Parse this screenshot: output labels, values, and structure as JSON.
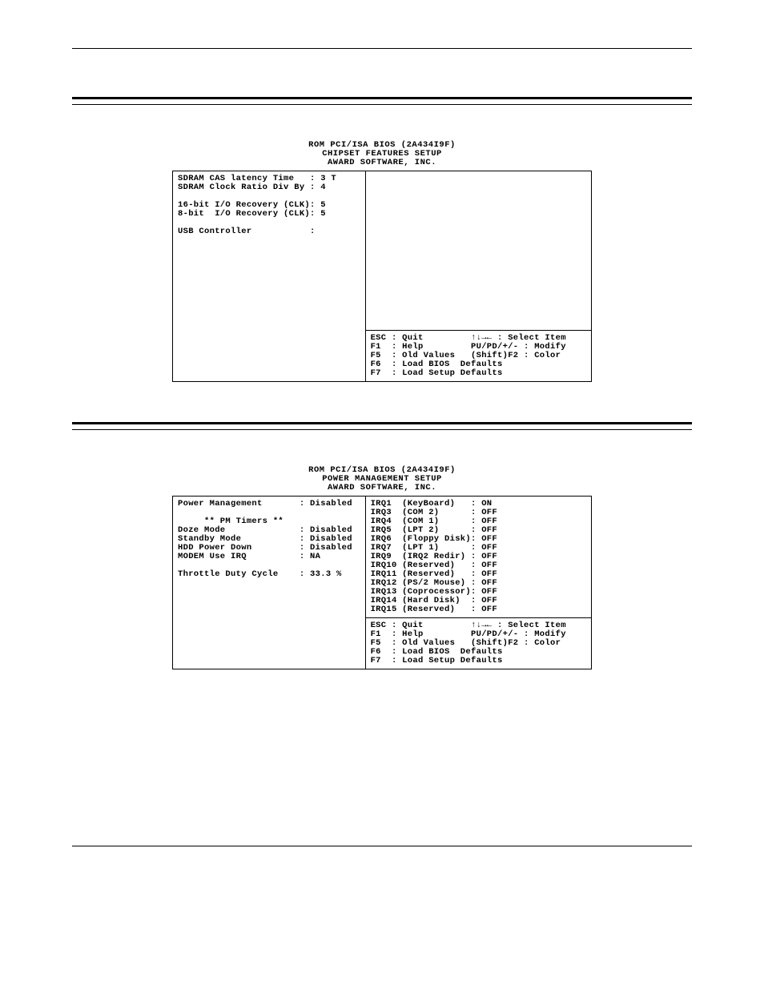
{
  "section1": {
    "title_lines": [
      "ROM PCI/ISA BIOS (2A434I9F)",
      "CHIPSET FEATURES SETUP",
      "AWARD SOFTWARE, INC."
    ],
    "left_rows": [
      "SDRAM CAS latency Time   : 3 T",
      "SDRAM Clock Ratio Div By : 4",
      "",
      "16-bit I/O Recovery (CLK): 5",
      "8-bit  I/O Recovery (CLK): 5",
      "",
      "USB Controller           :"
    ],
    "help_rows": [
      "ESC : Quit         ↑↓→← : Select Item",
      "F1  : Help         PU/PD/+/- : Modify",
      "F5  : Old Values   (Shift)F2 : Color",
      "F6  : Load BIOS  Defaults",
      "F7  : Load Setup Defaults"
    ]
  },
  "section2": {
    "title_lines": [
      "ROM PCI/ISA BIOS (2A434I9F)",
      "POWER MANAGEMENT SETUP",
      "AWARD SOFTWARE, INC."
    ],
    "left_rows": [
      "Power Management       : Disabled",
      "",
      "     ** PM Timers **",
      "Doze Mode              : Disabled",
      "Standby Mode           : Disabled",
      "HDD Power Down         : Disabled",
      "MODEM Use IRQ          : NA",
      "",
      "Throttle Duty Cycle    : 33.3 %"
    ],
    "right_rows": [
      "IRQ1  (KeyBoard)   : ON",
      "IRQ3  (COM 2)      : OFF",
      "IRQ4  (COM 1)      : OFF",
      "IRQ5  (LPT 2)      : OFF",
      "IRQ6  (Floppy Disk): OFF",
      "IRQ7  (LPT 1)      : OFF",
      "IRQ9  (IRQ2 Redir) : OFF",
      "IRQ10 (Reserved)   : OFF",
      "IRQ11 (Reserved)   : OFF",
      "IRQ12 (PS/2 Mouse) : OFF",
      "IRQ13 (Coprocessor): OFF",
      "IRQ14 (Hard Disk)  : OFF",
      "IRQ15 (Reserved)   : OFF"
    ],
    "help_rows": [
      "ESC : Quit         ↑↓→← : Select Item",
      "F1  : Help         PU/PD/+/- : Modify",
      "F5  : Old Values   (Shift)F2 : Color",
      "F6  : Load BIOS  Defaults",
      "F7  : Load Setup Defaults"
    ]
  }
}
